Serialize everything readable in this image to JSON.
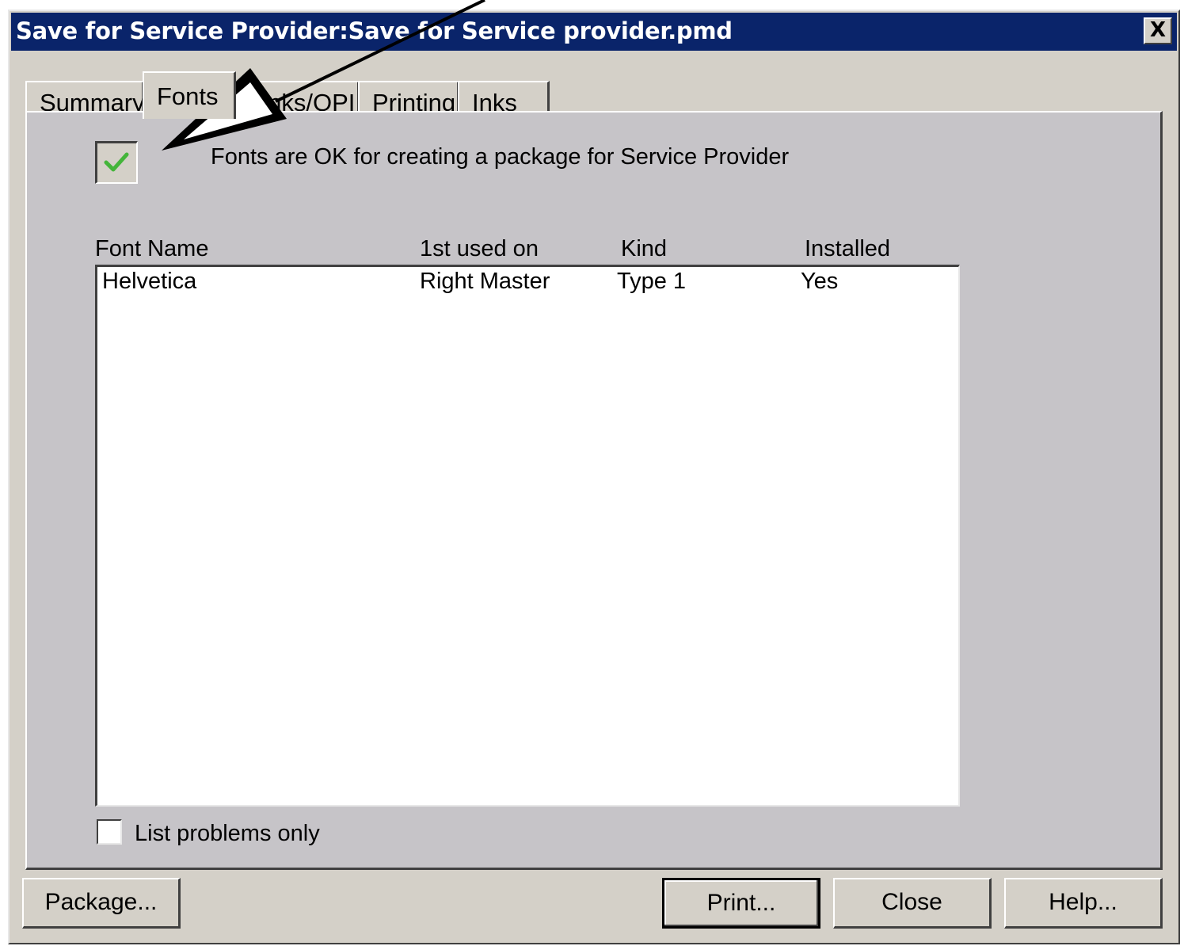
{
  "window": {
    "title": "Save for Service Provider:Save for Service provider.pmd",
    "close_glyph": "X"
  },
  "tabs": [
    {
      "label": "Summary",
      "active": false
    },
    {
      "label": "Fonts",
      "active": true
    },
    {
      "label": "Links/OPI",
      "active": false
    },
    {
      "label": "Printing",
      "active": false
    },
    {
      "label": "Inks",
      "active": false
    }
  ],
  "fonts_panel": {
    "status_checked": true,
    "status_text": "Fonts are OK for creating a package for Service Provider",
    "columns": [
      "Font Name",
      "1st used on",
      "Kind",
      "Installed"
    ],
    "rows": [
      {
        "font_name": "Helvetica",
        "first_used_on": "Right Master",
        "kind": "Type 1",
        "installed": "Yes"
      }
    ],
    "list_problems_only": {
      "label": "List problems only",
      "checked": false
    }
  },
  "buttons": {
    "package": "Package...",
    "print": "Print...",
    "close": "Close",
    "help": "Help..."
  },
  "colors": {
    "titlebar": "#0a246a",
    "dialog_face": "#d4d0c8",
    "panel_face": "#c6c4c8",
    "check_green": "#44b53a"
  }
}
